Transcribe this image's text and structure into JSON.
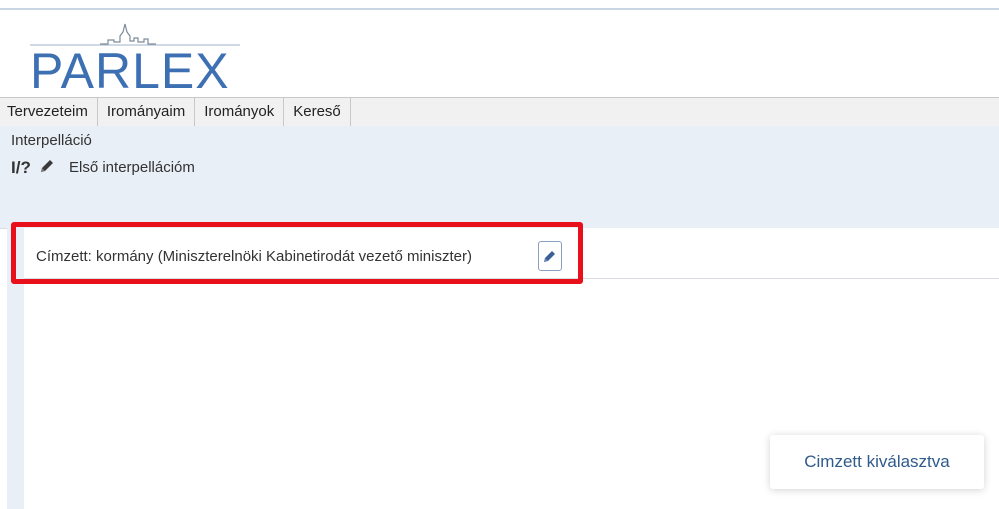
{
  "app": {
    "logo_text": "PARLEX"
  },
  "nav": {
    "items": [
      "Tervezeteim",
      "Irományaim",
      "Irományok",
      "Kereső"
    ]
  },
  "document": {
    "type_label": "Interpelláció",
    "id": "I/?",
    "title": "Első interpellációm"
  },
  "recipient": {
    "label": "Címzett: kormány (Miniszterelnöki Kabinetirodát vezető miniszter)",
    "edit_icon": "pencil-icon"
  },
  "toast": {
    "message": "Cimzett kiválasztva"
  },
  "colors": {
    "brand": "#3d6fb3",
    "highlight": "#e8101a",
    "panel": "#e9eff6"
  }
}
